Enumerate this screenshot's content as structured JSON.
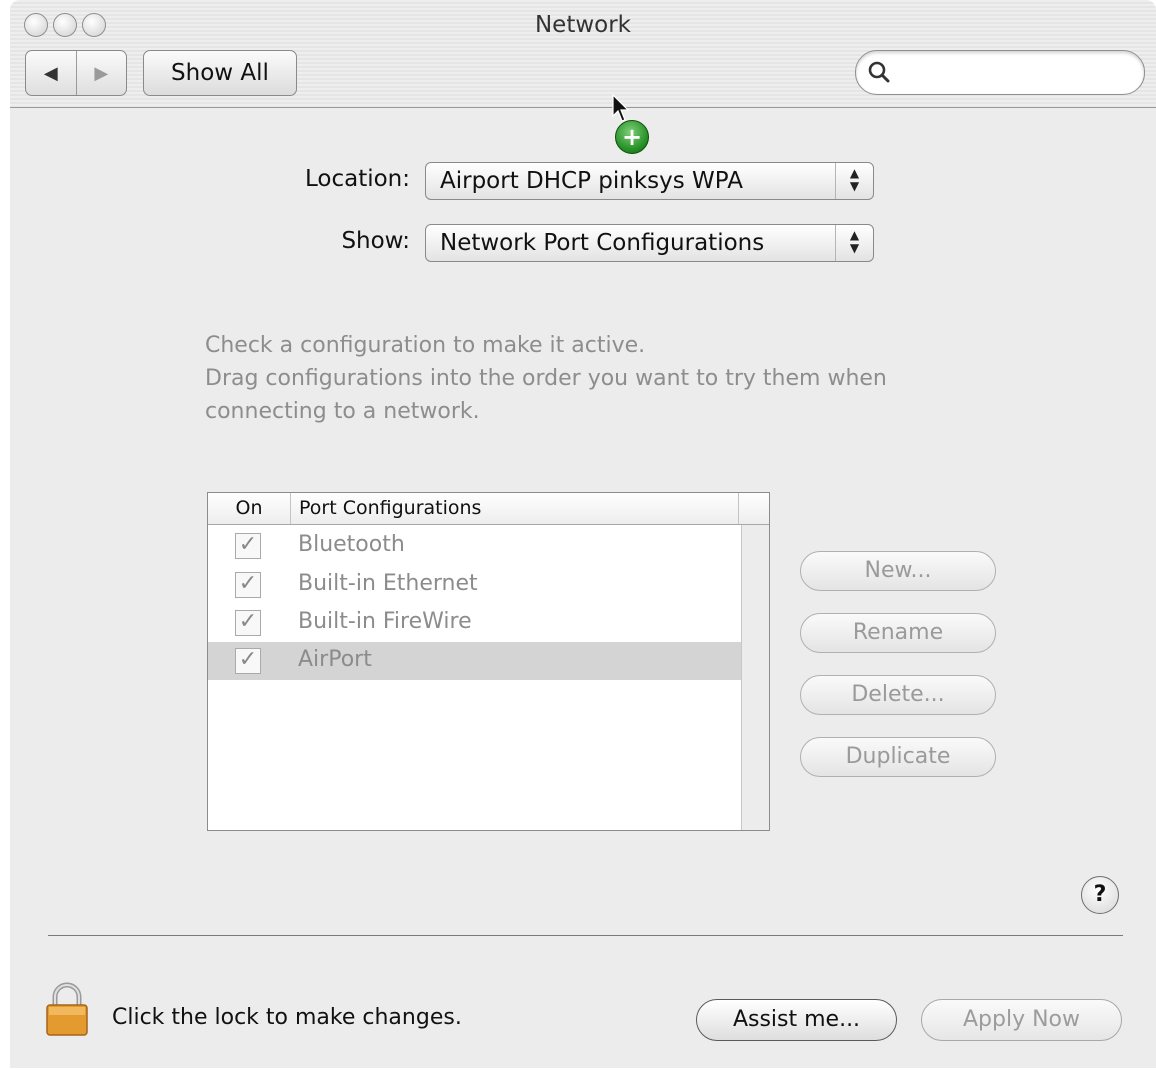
{
  "window": {
    "title": "Network"
  },
  "toolbar": {
    "back_glyph": "◀",
    "forward_glyph": "▶",
    "show_all_label": "Show All",
    "search_value": "",
    "search_icon": "magnifier-icon"
  },
  "location": {
    "label": "Location:",
    "value": "Airport DHCP pinksys WPA"
  },
  "show": {
    "label": "Show:",
    "value": "Network Port Configurations"
  },
  "instructions": {
    "line1": "Check a configuration to make it active.",
    "line2": "Drag configurations into the order you want to try them when connecting to a network."
  },
  "table": {
    "col_on": "On",
    "col_port": "Port Configurations",
    "rows": [
      {
        "name": "Bluetooth",
        "checked": true
      },
      {
        "name": "Built-in Ethernet",
        "checked": true
      },
      {
        "name": "Built-in FireWire",
        "checked": true
      },
      {
        "name": "AirPort",
        "checked": true,
        "selected": true
      }
    ]
  },
  "buttons": {
    "new": "New...",
    "rename": "Rename",
    "delete": "Delete...",
    "duplicate": "Duplicate"
  },
  "help_label": "?",
  "footer": {
    "lock_text": "Click the lock to make changes.",
    "assist": "Assist me...",
    "apply": "Apply Now"
  },
  "drag_badge": "+",
  "check_glyph": "✓",
  "popup_arrows": "▲▼"
}
